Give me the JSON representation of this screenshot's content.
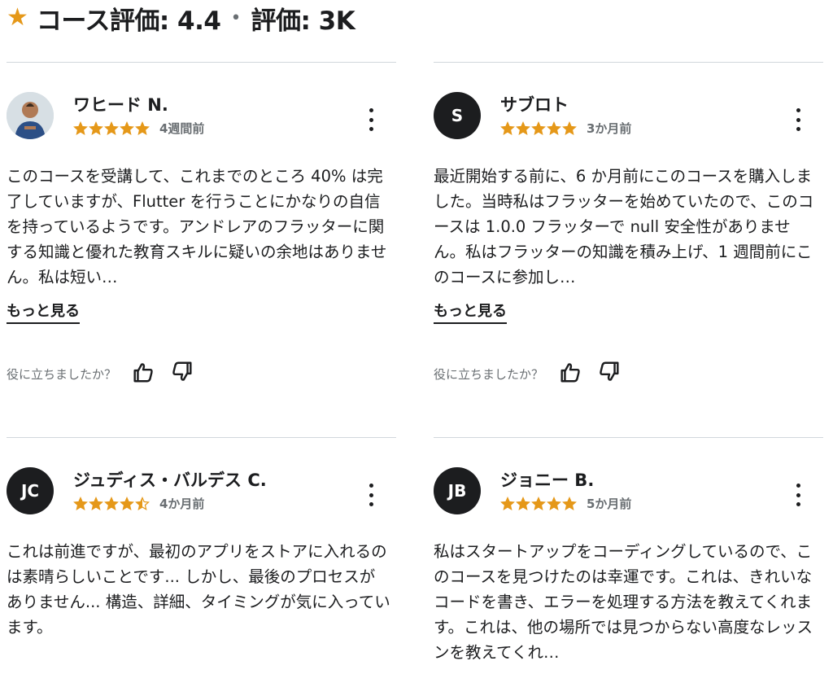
{
  "header": {
    "star": "★",
    "course_rating": "コース評価: 4.4",
    "separator": "•",
    "rating_count": "評価: 3K"
  },
  "colors": {
    "star": "#e59819",
    "text": "#1c1d1f",
    "muted": "#6a6f73",
    "divider": "#d1d7dc"
  },
  "helpful_label": "役に立ちましたか？",
  "see_more_label": "もっと見る",
  "reviews": [
    {
      "initials": "",
      "avatar_kind": "photo",
      "name": "ワヒード N.",
      "rating": 5,
      "date": "4週間前",
      "text": "このコースを受講して、これまでのところ 40% は完了していますが、Flutter を行うことにかなりの自信を持っているようです。アンドレアのフラッターに関する知識と優れた教育スキルに疑いの余地はありません。私は短い…"
    },
    {
      "initials": "S",
      "avatar_kind": "initials",
      "name": "サブロト",
      "rating": 5,
      "date": "3か月前",
      "text": "最近開始する前に、6 か月前にこのコースを購入しました。当時私はフラッターを始めていたので、このコースは 1.0.0 フラッターで null 安全性がありません。私はフラッターの知識を積み上げ、1 週間前にこのコースに参加し…"
    },
    {
      "initials": "JC",
      "avatar_kind": "initials",
      "name": "ジュディス・バルデス C.",
      "rating": 4.5,
      "date": "4か月前",
      "text": "これは前進ですが、最初のアプリをストアに入れるのは素晴らしいことです... しかし、最後のプロセスがありません... 構造、詳細、タイミングが気に入っています。"
    },
    {
      "initials": "JB",
      "avatar_kind": "initials",
      "name": "ジョニー B.",
      "rating": 5,
      "date": "5か月前",
      "text": "私はスタートアップをコーディングしているので、このコースを見つけたのは幸運です。これは、きれいなコードを書き、エラーを処理する方法を教えてくれます。これは、他の場所では見つからない高度なレッスンを教えてくれ…"
    }
  ]
}
